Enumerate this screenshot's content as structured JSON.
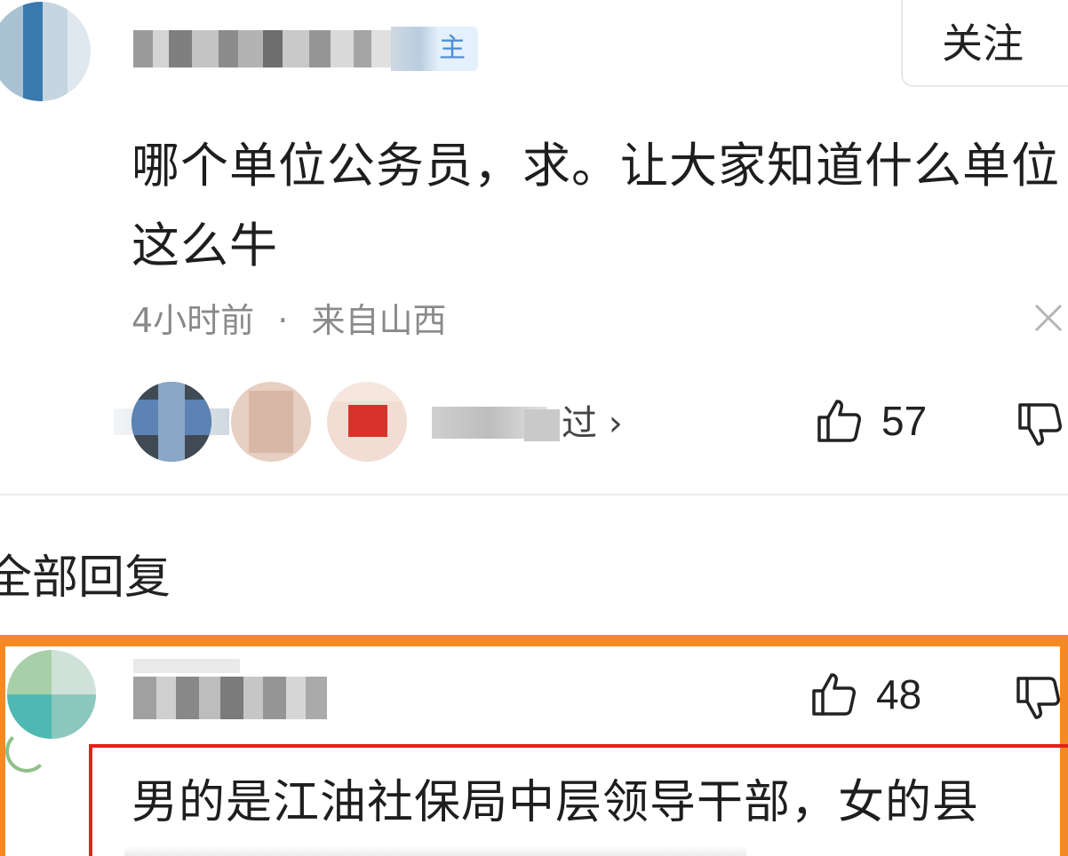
{
  "post": {
    "author_badge": "主",
    "follow_label": "关注",
    "comment_text": "哪个单位公务员，求。让大家知道什么单位这么牛",
    "time": "4小时前",
    "separator": "·",
    "location": "来自山西",
    "liked_by_suffix": "过 ›",
    "like_count": "57"
  },
  "replies_section": {
    "title": "全部回复"
  },
  "reply": {
    "like_count": "48",
    "text": "男的是江油社保局中层领导干部，女的县"
  },
  "colors": {
    "highlight_orange": "#f58a24",
    "highlight_red": "#e2231a",
    "badge_blue": "#4a8dd4",
    "meta_gray": "#8a8a8a"
  },
  "icons": {
    "close": "close-icon",
    "like": "thumbs-up-icon",
    "dislike": "thumbs-down-icon"
  }
}
